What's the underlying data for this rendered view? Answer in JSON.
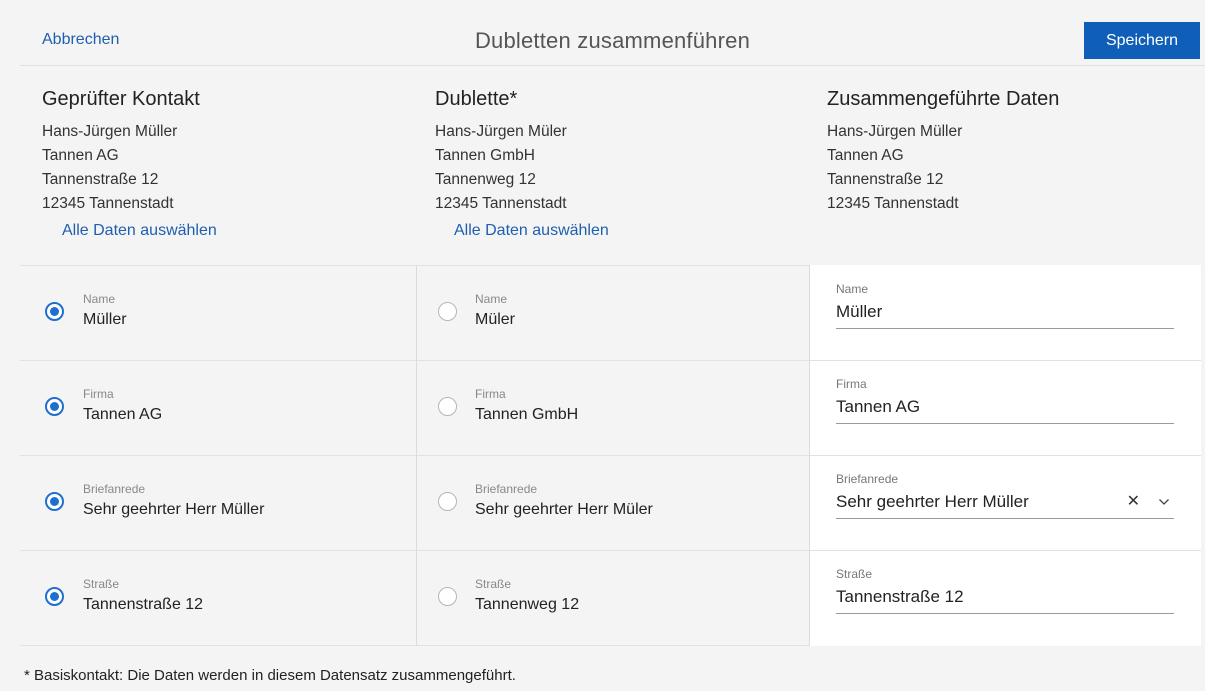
{
  "header": {
    "cancel_label": "Abbrechen",
    "title": "Dubletten zusammenführen",
    "save_label": "Speichern"
  },
  "columns": {
    "checked": {
      "title": "Geprüfter Kontakt",
      "lines": [
        "Hans-Jürgen Müller",
        "Tannen AG",
        "Tannenstraße 12",
        "12345 Tannenstadt"
      ],
      "select_all": "Alle Daten auswählen"
    },
    "duplicate": {
      "title": "Dublette*",
      "lines": [
        "Hans-Jürgen Müler",
        "Tannen GmbH",
        "Tannenweg 12",
        "12345 Tannenstadt"
      ],
      "select_all": "Alle Daten auswählen"
    },
    "merged": {
      "title": "Zusammengeführte Daten",
      "lines": [
        "Hans-Jürgen Müller",
        "Tannen AG",
        "Tannenstraße 12",
        "12345 Tannenstadt"
      ]
    }
  },
  "rows": [
    {
      "label": "Name",
      "checked_value": "Müller",
      "duplicate_value": "Müler",
      "merged_value": "Müller"
    },
    {
      "label": "Firma",
      "checked_value": "Tannen AG",
      "duplicate_value": "Tannen GmbH",
      "merged_value": "Tannen AG"
    },
    {
      "label": "Briefanrede",
      "checked_value": "Sehr geehrter Herr Müller",
      "duplicate_value": "Sehr geehrter Herr Müler",
      "merged_value": "Sehr geehrter Herr Müller"
    },
    {
      "label": "Straße",
      "checked_value": "Tannenstraße 12",
      "duplicate_value": "Tannenweg 12",
      "merged_value": "Tannenstraße 12"
    }
  ],
  "footnote": "* Basiskontakt: Die Daten werden in diesem Datensatz zusammengeführt.",
  "colors": {
    "accent": "#0f5fb8",
    "link": "#1f5fb0",
    "radio": "#1f6fce"
  }
}
